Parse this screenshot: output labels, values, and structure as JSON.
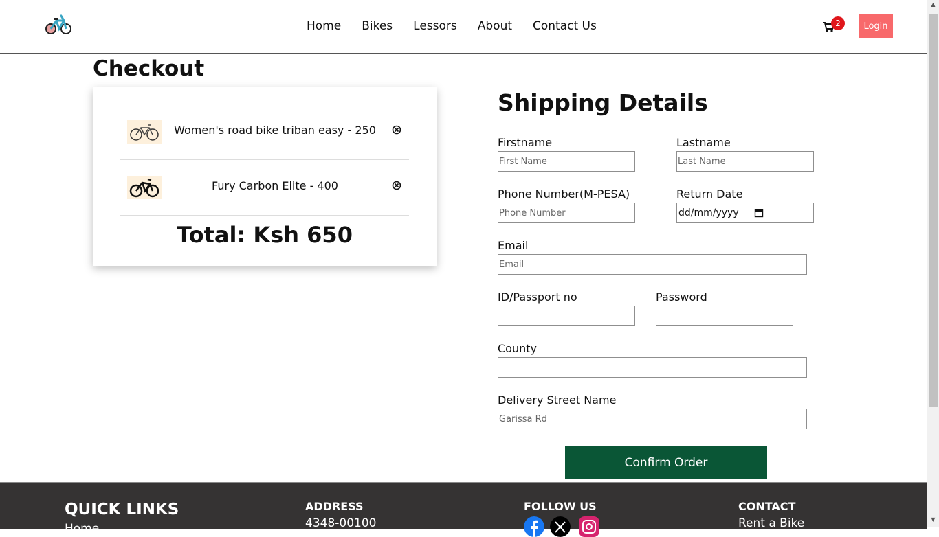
{
  "header": {
    "nav": [
      "Home",
      "Bikes",
      "Lessors",
      "About",
      "Contact Us"
    ],
    "cart_count": "2",
    "login_label": "Login"
  },
  "checkout": {
    "title": "Checkout",
    "items": [
      {
        "label": "Women's road bike triban easy - 250"
      },
      {
        "label": "Fury Carbon Elite - 400"
      }
    ],
    "total": "Total: Ksh 650"
  },
  "shipping": {
    "title": "Shipping Details",
    "firstname_label": "Firstname",
    "firstname_placeholder": "First Name",
    "lastname_label": "Lastname",
    "lastname_placeholder": "Last Name",
    "phone_label": "Phone Number(M-PESA)",
    "phone_placeholder": "Phone Number",
    "return_label": "Return Date",
    "return_value": "dd/mm/yyyy",
    "email_label": "Email",
    "email_placeholder": "Email",
    "id_label": "ID/Passport no",
    "password_label": "Password",
    "county_label": "County",
    "street_label": "Delivery Street Name",
    "street_placeholder": "Garissa Rd",
    "confirm_label": "Confirm Order"
  },
  "footer": {
    "quick_links_title": "QUICK LINKS",
    "quick_link_first": "Home",
    "address_title": "ADDRESS",
    "address_line": "4348-00100",
    "follow_title": "FOLLOW US",
    "contact_title": "CONTACT",
    "contact_line": "Rent a Bike"
  },
  "colors": {
    "login_bg": "#f8696b",
    "confirm_bg": "#0a5636",
    "footer_bg": "#353333",
    "badge_bg": "#e0161b"
  }
}
